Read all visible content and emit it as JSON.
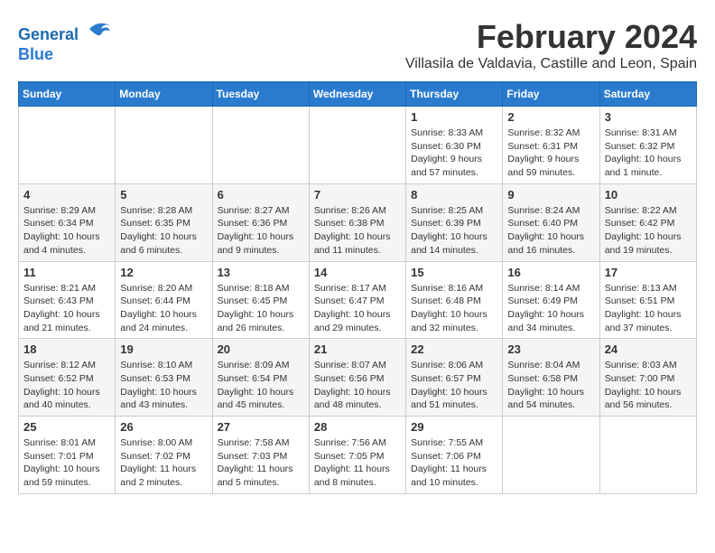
{
  "logo": {
    "line1": "General",
    "line2": "Blue"
  },
  "title": "February 2024",
  "location": "Villasila de Valdavia, Castille and Leon, Spain",
  "headers": [
    "Sunday",
    "Monday",
    "Tuesday",
    "Wednesday",
    "Thursday",
    "Friday",
    "Saturday"
  ],
  "weeks": [
    [
      {
        "day": "",
        "info": ""
      },
      {
        "day": "",
        "info": ""
      },
      {
        "day": "",
        "info": ""
      },
      {
        "day": "",
        "info": ""
      },
      {
        "day": "1",
        "info": "Sunrise: 8:33 AM\nSunset: 6:30 PM\nDaylight: 9 hours and 57 minutes."
      },
      {
        "day": "2",
        "info": "Sunrise: 8:32 AM\nSunset: 6:31 PM\nDaylight: 9 hours and 59 minutes."
      },
      {
        "day": "3",
        "info": "Sunrise: 8:31 AM\nSunset: 6:32 PM\nDaylight: 10 hours and 1 minute."
      }
    ],
    [
      {
        "day": "4",
        "info": "Sunrise: 8:29 AM\nSunset: 6:34 PM\nDaylight: 10 hours and 4 minutes."
      },
      {
        "day": "5",
        "info": "Sunrise: 8:28 AM\nSunset: 6:35 PM\nDaylight: 10 hours and 6 minutes."
      },
      {
        "day": "6",
        "info": "Sunrise: 8:27 AM\nSunset: 6:36 PM\nDaylight: 10 hours and 9 minutes."
      },
      {
        "day": "7",
        "info": "Sunrise: 8:26 AM\nSunset: 6:38 PM\nDaylight: 10 hours and 11 minutes."
      },
      {
        "day": "8",
        "info": "Sunrise: 8:25 AM\nSunset: 6:39 PM\nDaylight: 10 hours and 14 minutes."
      },
      {
        "day": "9",
        "info": "Sunrise: 8:24 AM\nSunset: 6:40 PM\nDaylight: 10 hours and 16 minutes."
      },
      {
        "day": "10",
        "info": "Sunrise: 8:22 AM\nSunset: 6:42 PM\nDaylight: 10 hours and 19 minutes."
      }
    ],
    [
      {
        "day": "11",
        "info": "Sunrise: 8:21 AM\nSunset: 6:43 PM\nDaylight: 10 hours and 21 minutes."
      },
      {
        "day": "12",
        "info": "Sunrise: 8:20 AM\nSunset: 6:44 PM\nDaylight: 10 hours and 24 minutes."
      },
      {
        "day": "13",
        "info": "Sunrise: 8:18 AM\nSunset: 6:45 PM\nDaylight: 10 hours and 26 minutes."
      },
      {
        "day": "14",
        "info": "Sunrise: 8:17 AM\nSunset: 6:47 PM\nDaylight: 10 hours and 29 minutes."
      },
      {
        "day": "15",
        "info": "Sunrise: 8:16 AM\nSunset: 6:48 PM\nDaylight: 10 hours and 32 minutes."
      },
      {
        "day": "16",
        "info": "Sunrise: 8:14 AM\nSunset: 6:49 PM\nDaylight: 10 hours and 34 minutes."
      },
      {
        "day": "17",
        "info": "Sunrise: 8:13 AM\nSunset: 6:51 PM\nDaylight: 10 hours and 37 minutes."
      }
    ],
    [
      {
        "day": "18",
        "info": "Sunrise: 8:12 AM\nSunset: 6:52 PM\nDaylight: 10 hours and 40 minutes."
      },
      {
        "day": "19",
        "info": "Sunrise: 8:10 AM\nSunset: 6:53 PM\nDaylight: 10 hours and 43 minutes."
      },
      {
        "day": "20",
        "info": "Sunrise: 8:09 AM\nSunset: 6:54 PM\nDaylight: 10 hours and 45 minutes."
      },
      {
        "day": "21",
        "info": "Sunrise: 8:07 AM\nSunset: 6:56 PM\nDaylight: 10 hours and 48 minutes."
      },
      {
        "day": "22",
        "info": "Sunrise: 8:06 AM\nSunset: 6:57 PM\nDaylight: 10 hours and 51 minutes."
      },
      {
        "day": "23",
        "info": "Sunrise: 8:04 AM\nSunset: 6:58 PM\nDaylight: 10 hours and 54 minutes."
      },
      {
        "day": "24",
        "info": "Sunrise: 8:03 AM\nSunset: 7:00 PM\nDaylight: 10 hours and 56 minutes."
      }
    ],
    [
      {
        "day": "25",
        "info": "Sunrise: 8:01 AM\nSunset: 7:01 PM\nDaylight: 10 hours and 59 minutes."
      },
      {
        "day": "26",
        "info": "Sunrise: 8:00 AM\nSunset: 7:02 PM\nDaylight: 11 hours and 2 minutes."
      },
      {
        "day": "27",
        "info": "Sunrise: 7:58 AM\nSunset: 7:03 PM\nDaylight: 11 hours and 5 minutes."
      },
      {
        "day": "28",
        "info": "Sunrise: 7:56 AM\nSunset: 7:05 PM\nDaylight: 11 hours and 8 minutes."
      },
      {
        "day": "29",
        "info": "Sunrise: 7:55 AM\nSunset: 7:06 PM\nDaylight: 11 hours and 10 minutes."
      },
      {
        "day": "",
        "info": ""
      },
      {
        "day": "",
        "info": ""
      }
    ]
  ]
}
